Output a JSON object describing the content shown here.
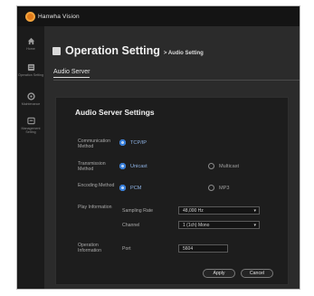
{
  "brand": {
    "name": "Hanwha Vision",
    "accent": "#e07a1a"
  },
  "sidebar": {
    "items": [
      {
        "label": "Home",
        "icon": "home-icon"
      },
      {
        "label": "Operation Setting",
        "icon": "operation-setting-icon"
      },
      {
        "label": "Maintenance",
        "icon": "maintenance-icon"
      },
      {
        "label": "Management Setting",
        "icon": "management-setting-icon"
      }
    ]
  },
  "header": {
    "title": "Operation Setting",
    "breadcrumb": "> Audio Setting"
  },
  "tab": {
    "label": "Audio Server"
  },
  "panel": {
    "title": "Audio Server Settings",
    "communication": {
      "label": "Communication Method",
      "options": [
        "TCP/IP"
      ],
      "selected": "TCP/IP"
    },
    "transmission": {
      "label": "Transmission Method",
      "options": [
        "Unicast",
        "Multicast"
      ],
      "selected": "Unicast"
    },
    "encoding": {
      "label": "Encoding Method",
      "options": [
        "PCM",
        "MP3"
      ],
      "selected": "PCM"
    },
    "play": {
      "label": "Play Information",
      "sampling_label": "Sampling Rate",
      "sampling_value": "48,000 Hz",
      "channel_label": "Channel",
      "channel_value": "1 (1ch) Mono"
    },
    "operation": {
      "label": "Operation Information",
      "port_label": "Port",
      "port_value": "5604"
    },
    "buttons": {
      "apply": "Apply",
      "cancel": "Cancel"
    }
  },
  "colors": {
    "selected_radio": "#2f78d6",
    "background": "#2b2b2b",
    "panel": "#1d1d1d"
  }
}
